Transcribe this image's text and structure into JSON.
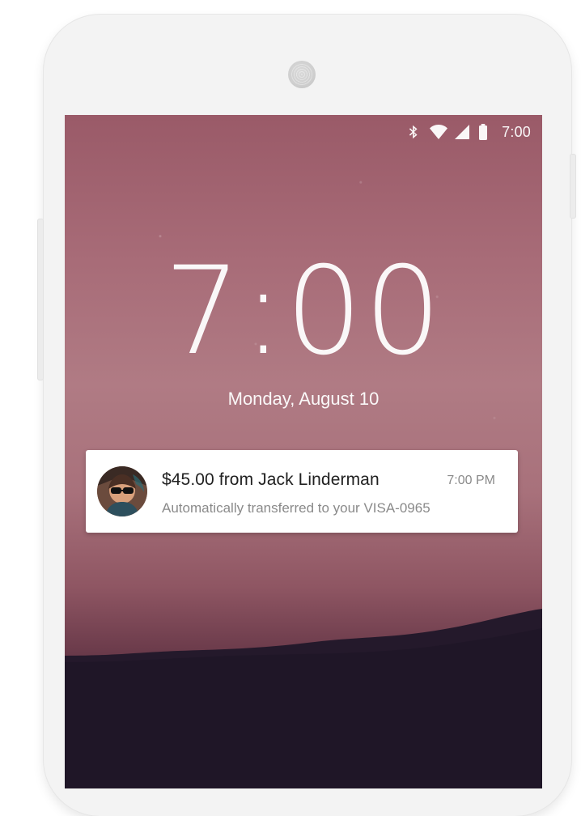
{
  "status_bar": {
    "time": "7:00",
    "icons": [
      "bluetooth-icon",
      "wifi-icon",
      "cellular-signal-icon",
      "battery-icon"
    ]
  },
  "lockscreen": {
    "clock": "7:00",
    "date": "Monday, August 10"
  },
  "notification": {
    "title": "$45.00 from Jack Linderman",
    "time": "7:00 PM",
    "text": "Automatically transferred to your VISA-0965",
    "avatar": "avatar-icon"
  },
  "colors": {
    "wallpaper_top": "#9a5a68",
    "wallpaper_mid": "#b07b84",
    "wallpaper_bottom": "#24192b",
    "notification_title": "#212121",
    "notification_meta": "#8a8a8a"
  }
}
